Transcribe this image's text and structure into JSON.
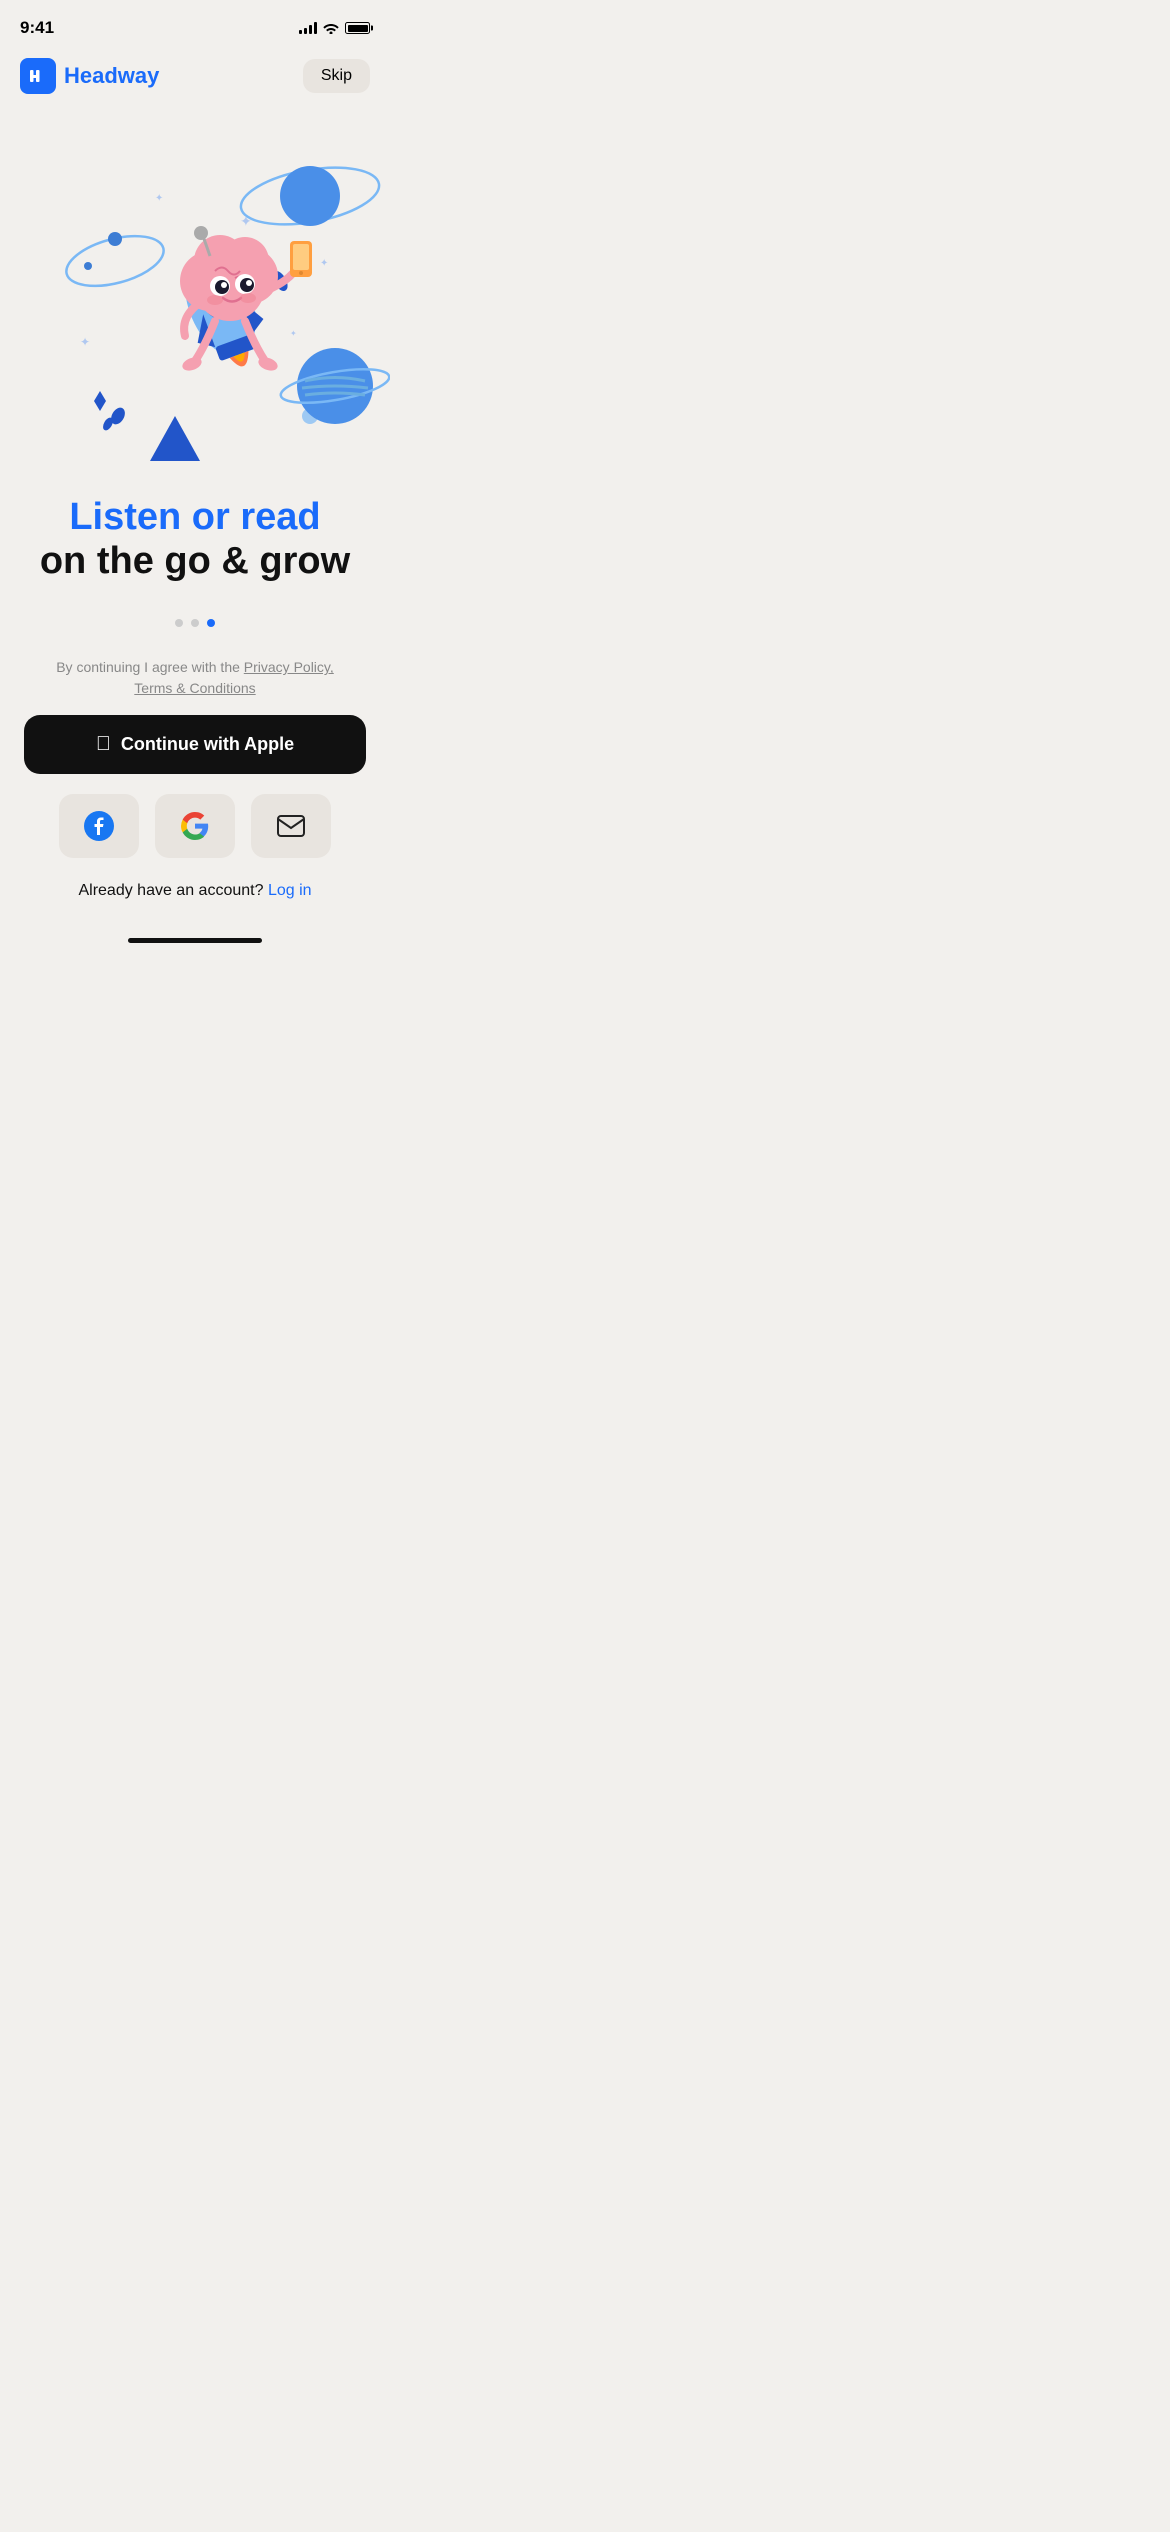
{
  "statusBar": {
    "time": "9:41"
  },
  "header": {
    "logoText": "Headway",
    "skipLabel": "Skip"
  },
  "hero": {
    "headlineBlue": "Listen or read",
    "headlineBlack": "on the go & grow"
  },
  "dots": [
    {
      "active": false
    },
    {
      "active": false
    },
    {
      "active": true
    }
  ],
  "legal": {
    "prefix": "By continuing I agree with the",
    "privacyPolicy": "Privacy Policy,",
    "termsConditions": "Terms & Conditions"
  },
  "buttons": {
    "appleLabel": "Continue with Apple",
    "loginText": "Already have an account?",
    "loginLink": "Log in"
  }
}
